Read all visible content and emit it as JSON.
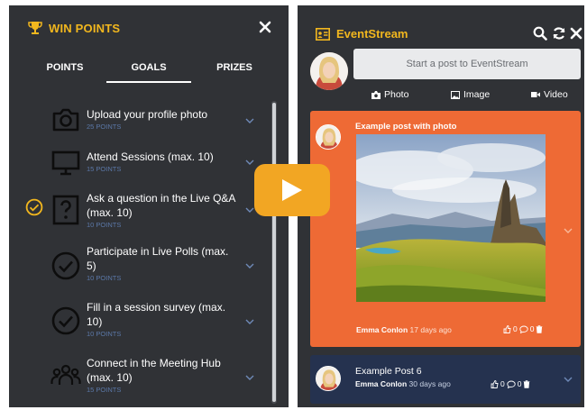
{
  "left_panel": {
    "title": "WIN POINTS",
    "tabs": [
      "POINTS",
      "GOALS",
      "PRIZES"
    ],
    "active_tab": "GOALS",
    "goals": [
      {
        "label": "Upload your profile photo",
        "points": "25 POINTS",
        "icon": "camera-icon",
        "completed": false
      },
      {
        "label": "Attend Sessions (max. 10)",
        "points": "15 POINTS",
        "icon": "monitor-icon",
        "completed": false
      },
      {
        "label": "Ask a question in the Live Q&A (max. 10)",
        "points": "10 POINTS",
        "icon": "question-box-icon",
        "completed": true
      },
      {
        "label": "Participate in Live Polls (max. 5)",
        "points": "10 POINTS",
        "icon": "check-circle-icon",
        "completed": false
      },
      {
        "label": "Fill in a session survey (max. 10)",
        "points": "10 POINTS",
        "icon": "check-circle-icon",
        "completed": false
      },
      {
        "label": "Connect in the Meeting Hub (max. 10)",
        "points": "15 POINTS",
        "icon": "people-group-icon",
        "completed": false
      }
    ]
  },
  "right_panel": {
    "title": "EventStream",
    "compose_placeholder": "Start a post to EventStream",
    "media_buttons": [
      "Photo",
      "Image",
      "Video"
    ],
    "posts": [
      {
        "title": "Example post with photo",
        "author": "Emma Conlon",
        "time": "17 days ago",
        "likes": "0",
        "comments": "0",
        "has_photo": true
      },
      {
        "title": "Example Post 6",
        "author": "Emma Conlon",
        "time": "30 days ago",
        "likes": "0",
        "comments": "0",
        "has_photo": false
      }
    ]
  },
  "colors": {
    "panel_bg": "#303236",
    "accent_gold": "#f2b71e",
    "post_orange": "#ee6a35",
    "post_navy": "#25324f",
    "play_button": "#f2a623",
    "points_blue": "#5b78a8"
  }
}
